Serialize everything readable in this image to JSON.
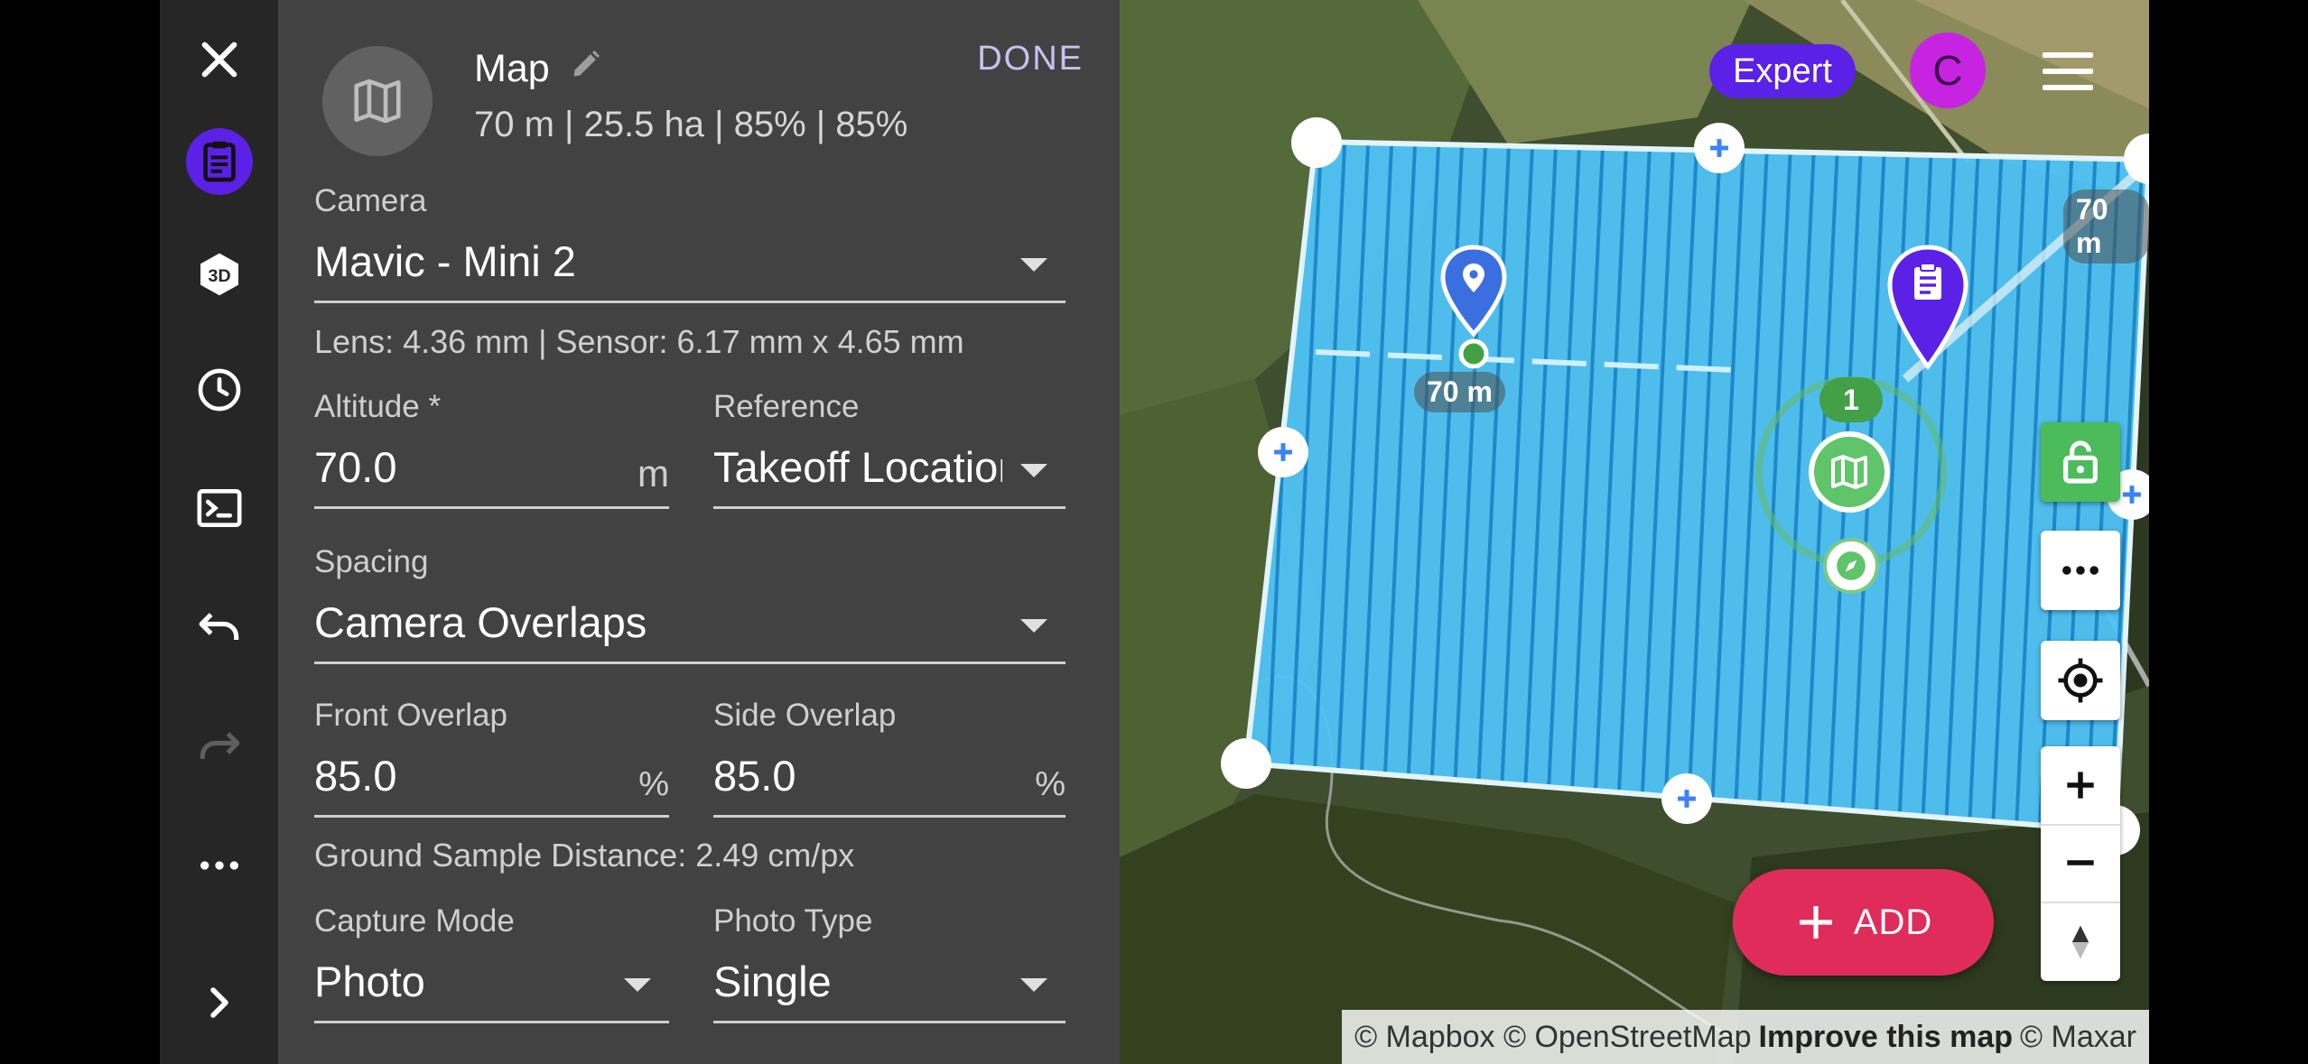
{
  "toolbar": {
    "items": [
      {
        "name": "close",
        "icon": "close-icon"
      },
      {
        "name": "mission",
        "icon": "clipboard-icon",
        "active": true
      },
      {
        "name": "3d",
        "icon": "3d-icon"
      },
      {
        "name": "history",
        "icon": "clock-icon"
      },
      {
        "name": "console",
        "icon": "terminal-icon"
      },
      {
        "name": "undo",
        "icon": "undo-icon"
      },
      {
        "name": "redo",
        "icon": "redo-icon",
        "disabled": true
      },
      {
        "name": "more",
        "icon": "more-horizontal-icon"
      },
      {
        "name": "expand",
        "icon": "chevron-right-icon"
      }
    ],
    "active_color": "#5b21e6"
  },
  "panel": {
    "icon": "map-icon",
    "title": "Map",
    "summary": "70 m | 25.5 ha | 85% | 85%",
    "done_label": "DONE",
    "camera": {
      "label": "Camera",
      "value": "Mavic - Mini 2"
    },
    "lens_info": "Lens: 4.36 mm | Sensor: 6.17 mm x 4.65 mm",
    "altitude": {
      "label": "Altitude *",
      "value": "70.0",
      "unit": "m"
    },
    "reference": {
      "label": "Reference",
      "value": "Takeoff Location"
    },
    "spacing": {
      "label": "Spacing",
      "value": "Camera Overlaps"
    },
    "front_overlap": {
      "label": "Front Overlap",
      "value": "85.0",
      "unit": "%"
    },
    "side_overlap": {
      "label": "Side Overlap",
      "value": "85.0",
      "unit": "%"
    },
    "gsd": "Ground Sample Distance: 2.49 cm/px",
    "capture_mode": {
      "label": "Capture Mode",
      "value": "Photo"
    },
    "photo_type": {
      "label": "Photo Type",
      "value": "Single"
    }
  },
  "map": {
    "expert_label": "Expert",
    "avatar_letter": "C",
    "altitude_label_top": "70 m",
    "altitude_label_left": "70 m",
    "waypoint_number": "1",
    "add_label": "ADD",
    "attribution": {
      "mapbox": "© Mapbox",
      "osm": "© OpenStreetMap",
      "improve": "Improve this map",
      "maxar": "© Maxar"
    },
    "colors": {
      "accent": "#5b21e6",
      "survey_fill": "#4fc3f7",
      "add": "#e02c5a",
      "lock": "#4cbb5a",
      "avatar": "#c624e0"
    }
  }
}
